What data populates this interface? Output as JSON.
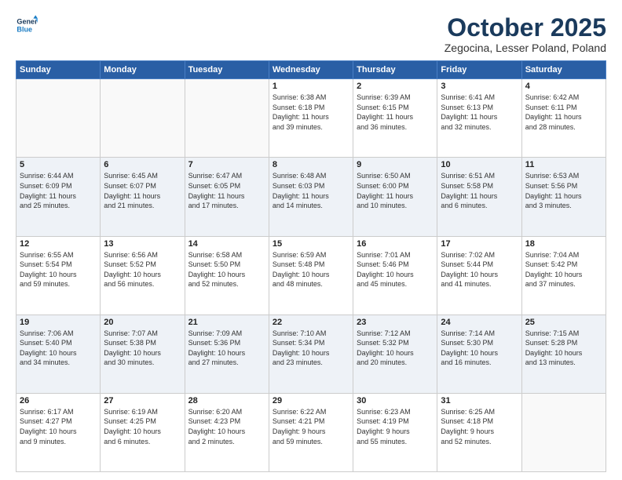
{
  "header": {
    "logo_general": "General",
    "logo_blue": "Blue",
    "month": "October 2025",
    "location": "Zegocina, Lesser Poland, Poland"
  },
  "days_of_week": [
    "Sunday",
    "Monday",
    "Tuesday",
    "Wednesday",
    "Thursday",
    "Friday",
    "Saturday"
  ],
  "weeks": [
    [
      {
        "day": "",
        "info": ""
      },
      {
        "day": "",
        "info": ""
      },
      {
        "day": "",
        "info": ""
      },
      {
        "day": "1",
        "info": "Sunrise: 6:38 AM\nSunset: 6:18 PM\nDaylight: 11 hours\nand 39 minutes."
      },
      {
        "day": "2",
        "info": "Sunrise: 6:39 AM\nSunset: 6:15 PM\nDaylight: 11 hours\nand 36 minutes."
      },
      {
        "day": "3",
        "info": "Sunrise: 6:41 AM\nSunset: 6:13 PM\nDaylight: 11 hours\nand 32 minutes."
      },
      {
        "day": "4",
        "info": "Sunrise: 6:42 AM\nSunset: 6:11 PM\nDaylight: 11 hours\nand 28 minutes."
      }
    ],
    [
      {
        "day": "5",
        "info": "Sunrise: 6:44 AM\nSunset: 6:09 PM\nDaylight: 11 hours\nand 25 minutes."
      },
      {
        "day": "6",
        "info": "Sunrise: 6:45 AM\nSunset: 6:07 PM\nDaylight: 11 hours\nand 21 minutes."
      },
      {
        "day": "7",
        "info": "Sunrise: 6:47 AM\nSunset: 6:05 PM\nDaylight: 11 hours\nand 17 minutes."
      },
      {
        "day": "8",
        "info": "Sunrise: 6:48 AM\nSunset: 6:03 PM\nDaylight: 11 hours\nand 14 minutes."
      },
      {
        "day": "9",
        "info": "Sunrise: 6:50 AM\nSunset: 6:00 PM\nDaylight: 11 hours\nand 10 minutes."
      },
      {
        "day": "10",
        "info": "Sunrise: 6:51 AM\nSunset: 5:58 PM\nDaylight: 11 hours\nand 6 minutes."
      },
      {
        "day": "11",
        "info": "Sunrise: 6:53 AM\nSunset: 5:56 PM\nDaylight: 11 hours\nand 3 minutes."
      }
    ],
    [
      {
        "day": "12",
        "info": "Sunrise: 6:55 AM\nSunset: 5:54 PM\nDaylight: 10 hours\nand 59 minutes."
      },
      {
        "day": "13",
        "info": "Sunrise: 6:56 AM\nSunset: 5:52 PM\nDaylight: 10 hours\nand 56 minutes."
      },
      {
        "day": "14",
        "info": "Sunrise: 6:58 AM\nSunset: 5:50 PM\nDaylight: 10 hours\nand 52 minutes."
      },
      {
        "day": "15",
        "info": "Sunrise: 6:59 AM\nSunset: 5:48 PM\nDaylight: 10 hours\nand 48 minutes."
      },
      {
        "day": "16",
        "info": "Sunrise: 7:01 AM\nSunset: 5:46 PM\nDaylight: 10 hours\nand 45 minutes."
      },
      {
        "day": "17",
        "info": "Sunrise: 7:02 AM\nSunset: 5:44 PM\nDaylight: 10 hours\nand 41 minutes."
      },
      {
        "day": "18",
        "info": "Sunrise: 7:04 AM\nSunset: 5:42 PM\nDaylight: 10 hours\nand 37 minutes."
      }
    ],
    [
      {
        "day": "19",
        "info": "Sunrise: 7:06 AM\nSunset: 5:40 PM\nDaylight: 10 hours\nand 34 minutes."
      },
      {
        "day": "20",
        "info": "Sunrise: 7:07 AM\nSunset: 5:38 PM\nDaylight: 10 hours\nand 30 minutes."
      },
      {
        "day": "21",
        "info": "Sunrise: 7:09 AM\nSunset: 5:36 PM\nDaylight: 10 hours\nand 27 minutes."
      },
      {
        "day": "22",
        "info": "Sunrise: 7:10 AM\nSunset: 5:34 PM\nDaylight: 10 hours\nand 23 minutes."
      },
      {
        "day": "23",
        "info": "Sunrise: 7:12 AM\nSunset: 5:32 PM\nDaylight: 10 hours\nand 20 minutes."
      },
      {
        "day": "24",
        "info": "Sunrise: 7:14 AM\nSunset: 5:30 PM\nDaylight: 10 hours\nand 16 minutes."
      },
      {
        "day": "25",
        "info": "Sunrise: 7:15 AM\nSunset: 5:28 PM\nDaylight: 10 hours\nand 13 minutes."
      }
    ],
    [
      {
        "day": "26",
        "info": "Sunrise: 6:17 AM\nSunset: 4:27 PM\nDaylight: 10 hours\nand 9 minutes."
      },
      {
        "day": "27",
        "info": "Sunrise: 6:19 AM\nSunset: 4:25 PM\nDaylight: 10 hours\nand 6 minutes."
      },
      {
        "day": "28",
        "info": "Sunrise: 6:20 AM\nSunset: 4:23 PM\nDaylight: 10 hours\nand 2 minutes."
      },
      {
        "day": "29",
        "info": "Sunrise: 6:22 AM\nSunset: 4:21 PM\nDaylight: 9 hours\nand 59 minutes."
      },
      {
        "day": "30",
        "info": "Sunrise: 6:23 AM\nSunset: 4:19 PM\nDaylight: 9 hours\nand 55 minutes."
      },
      {
        "day": "31",
        "info": "Sunrise: 6:25 AM\nSunset: 4:18 PM\nDaylight: 9 hours\nand 52 minutes."
      },
      {
        "day": "",
        "info": ""
      }
    ]
  ]
}
